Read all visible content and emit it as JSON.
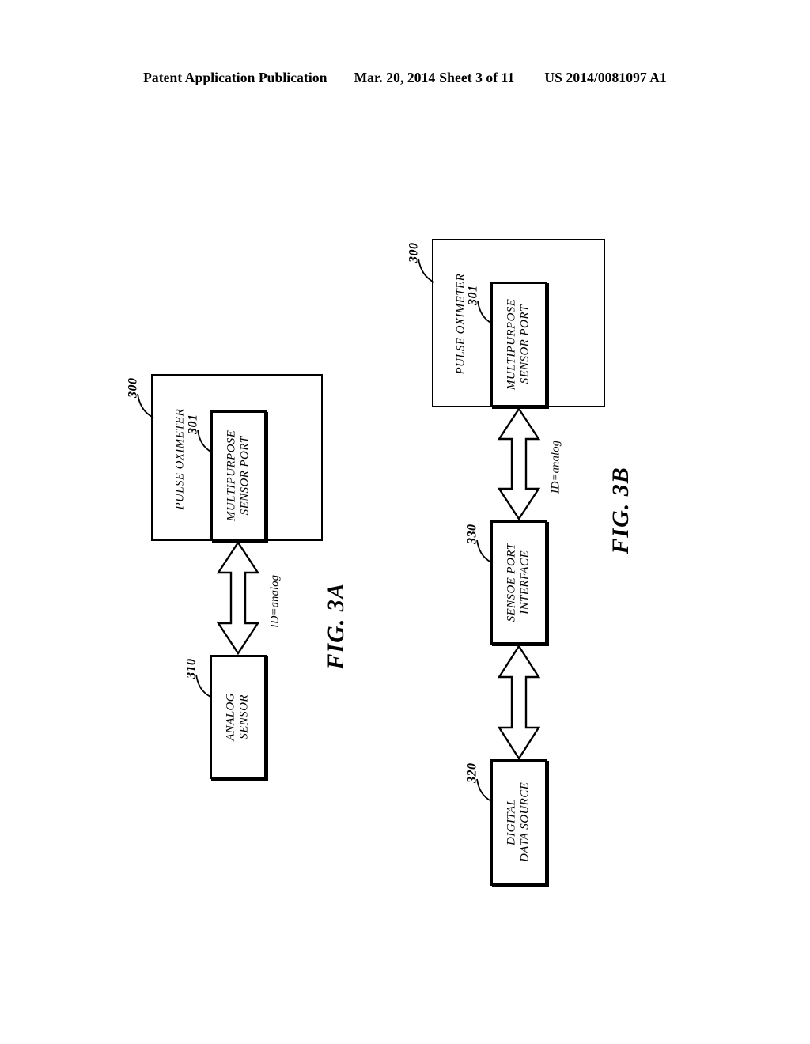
{
  "header": {
    "publication": "Patent Application Publication",
    "date": "Mar. 20, 2014",
    "sheet": "Sheet 3 of 11",
    "patent_number": "US 2014/0081097 A1"
  },
  "figures": [
    {
      "caption": "FIG. 3A",
      "blocks": [
        {
          "ref": "300",
          "label": "PULSE OXIMETER",
          "label_lines": [
            "PULSE OXIMETER"
          ]
        },
        {
          "ref": "301",
          "label": "MULTIPURPOSE SENSOR PORT",
          "label_lines": [
            "MULTIPURPOSE",
            "SENSOR PORT"
          ]
        },
        {
          "ref": "310",
          "label": "ANALOG SENSOR",
          "label_lines": [
            "ANALOG",
            "SENSOR"
          ]
        }
      ],
      "connectors": [
        {
          "label": "ID=analog",
          "from": "310",
          "to": "301",
          "style": "double-headed-hollow-arrow"
        }
      ]
    },
    {
      "caption": "FIG. 3B",
      "blocks": [
        {
          "ref": "300",
          "label": "PULSE OXIMETER",
          "label_lines": [
            "PULSE OXIMETER"
          ]
        },
        {
          "ref": "301",
          "label": "MULTIPURPOSE SENSOR PORT",
          "label_lines": [
            "MULTIPURPOSE",
            "SENSOR PORT"
          ]
        },
        {
          "ref": "330",
          "label": "SENSOE PORT INTERFACE",
          "label_lines": [
            "SENSOE PORT",
            "INTERFACE"
          ]
        },
        {
          "ref": "320",
          "label": "DIGITAL DATA SOURCE",
          "label_lines": [
            "DIGITAL",
            "DATA SOURCE"
          ]
        }
      ],
      "connectors": [
        {
          "label": "ID=analog",
          "from": "330",
          "to": "301",
          "style": "double-headed-hollow-arrow"
        },
        {
          "label": "",
          "from": "320",
          "to": "330",
          "style": "double-headed-hollow-arrow"
        }
      ]
    }
  ]
}
